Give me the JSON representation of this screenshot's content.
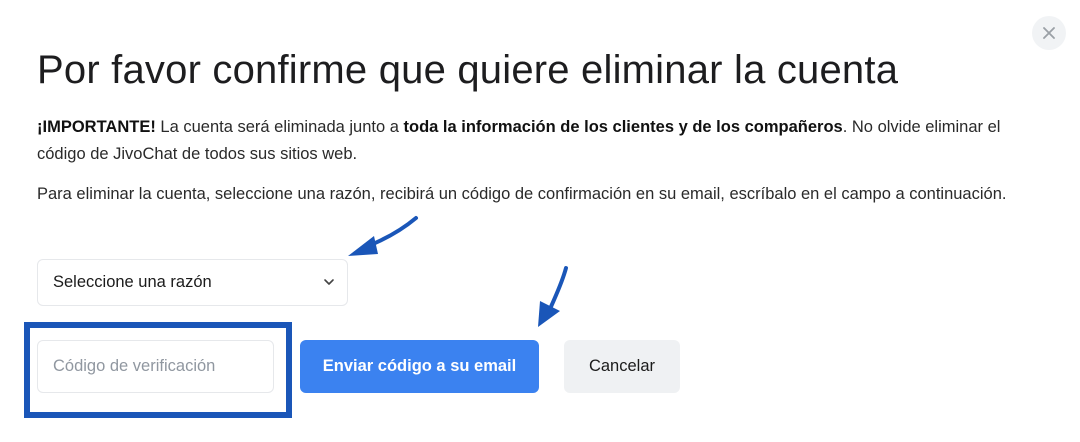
{
  "dialog": {
    "title": "Por favor confirme que quiere eliminar la cuenta",
    "close_icon": "close-icon"
  },
  "warning": {
    "important": "¡IMPORTANTE!",
    "text_a": " La cuenta será eliminada junto a ",
    "emphasis": "toda la información de los clientes y de los compañeros",
    "text_b": ". No olvide eliminar el código de JivoChat de todos sus sitios web."
  },
  "instructions": "Para eliminar la cuenta, seleccione una razón, recibirá un código de confirmación en su email, escríbalo en el campo a continuación.",
  "reason_select": {
    "selected": "Seleccione una razón",
    "icon": "chevron-down-icon"
  },
  "verification_input": {
    "value": "",
    "placeholder": "Código de verificación"
  },
  "buttons": {
    "send_code": "Enviar código a su email",
    "cancel": "Cancelar"
  },
  "colors": {
    "primary": "#3b82f0",
    "annotation": "#1a56b8",
    "secondary_bg": "#eff1f3"
  }
}
